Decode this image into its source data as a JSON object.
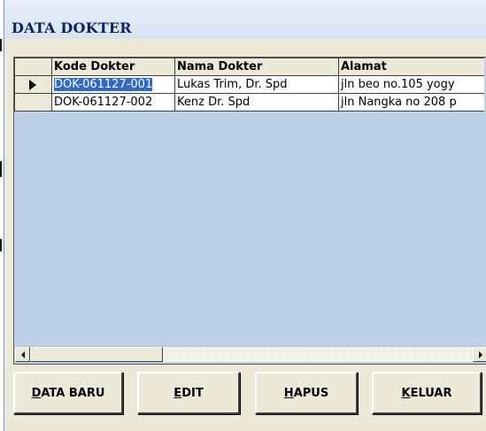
{
  "window": {
    "title": "DATA DOKTER"
  },
  "grid": {
    "columns": [
      "Kode Dokter",
      "Nama Dokter",
      "Alamat"
    ],
    "rows": [
      {
        "kode": "DOK-061127-001",
        "nama": "Lukas Trim, Dr. Spd",
        "alamat": "jln beo no.105 yogy",
        "current": true,
        "kode_selected": true
      },
      {
        "kode": "DOK-061127-002",
        "nama": "Kenz Dr. Spd",
        "alamat": "jln Nangka no 208 p",
        "current": false,
        "kode_selected": false
      }
    ],
    "row_indicator_icon": "current-row-arrow-icon"
  },
  "scrollbar": {
    "left_icon": "arrow-left-icon",
    "right_icon": "arrow-right-icon"
  },
  "buttons": {
    "data_baru": {
      "mnemonic": "D",
      "rest": "ATA BARU"
    },
    "edit": {
      "mnemonic": "E",
      "rest": "DIT"
    },
    "hapus": {
      "mnemonic": "H",
      "rest": "APUS"
    },
    "keluar": {
      "mnemonic": "K",
      "rest": "ELUAR"
    }
  },
  "colors": {
    "title_text": "#0a246a",
    "window_bg": "#ECE9D8",
    "grid_empty_bg": "#bed0e8",
    "selection": "#316ac5"
  }
}
